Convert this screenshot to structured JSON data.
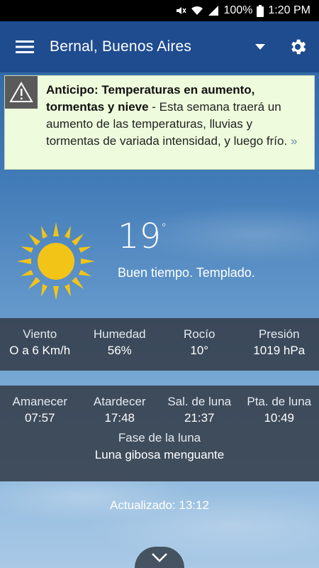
{
  "status_bar": {
    "battery": "100%",
    "time": "1:20 PM"
  },
  "app_bar": {
    "location": "Bernal, Buenos Aires",
    "menu_icon": "hamburger-menu-icon",
    "dropdown_icon": "dropdown-arrow-icon",
    "settings_icon": "gear-icon"
  },
  "alert": {
    "icon": "warning-icon",
    "title": "Anticipo: Temperaturas en aumento, tormentas y nieve",
    "body": " - Esta semana traerá un aumento de las temperaturas, lluvias y tormentas de variada intensidad, y luego frío. ",
    "link": "»"
  },
  "current": {
    "icon": "sun-icon",
    "temperature": "19",
    "degree_symbol": "°",
    "condition": "Buen tiempo. Templado."
  },
  "details": [
    {
      "label": "Viento",
      "value": "O a 6 Km/h"
    },
    {
      "label": "Humedad",
      "value": "56%"
    },
    {
      "label": "Rocío",
      "value": "10°"
    },
    {
      "label": "Presión",
      "value": "1019 hPa"
    }
  ],
  "astro": [
    {
      "label": "Amanecer",
      "value": "07:57"
    },
    {
      "label": "Atardecer",
      "value": "17:48"
    },
    {
      "label": "Sal. de luna",
      "value": "21:37"
    },
    {
      "label": "Pta. de luna",
      "value": "10:49"
    }
  ],
  "moon_phase": {
    "label": "Fase de la luna",
    "value": "Luna gibosa menguante"
  },
  "updated": "Actualizado: 13:12",
  "expand_icon": "chevron-down-icon",
  "colors": {
    "app_bar": "#1f4b8f",
    "alert_bg": "#eefbdc",
    "sun": "#f2c418",
    "panel": "#343e4a"
  }
}
